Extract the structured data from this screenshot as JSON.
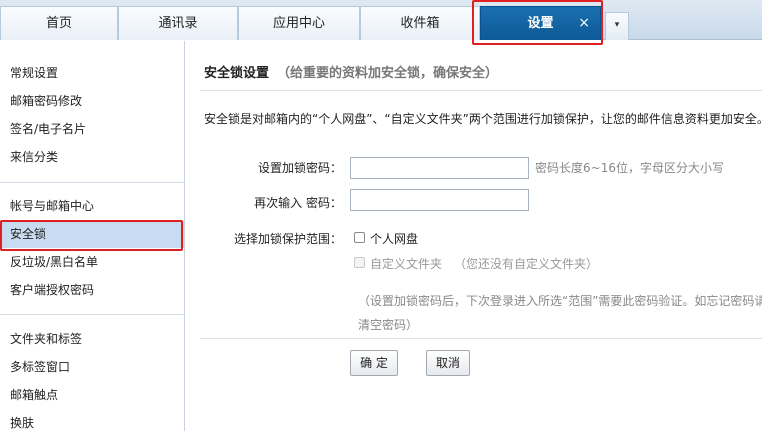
{
  "tabs": [
    {
      "label": "首页"
    },
    {
      "label": "通讯录"
    },
    {
      "label": "应用中心"
    },
    {
      "label": "收件箱"
    },
    {
      "label": "设置",
      "active": true
    }
  ],
  "tab_close": "×",
  "tab_more": "▾",
  "sidebar": {
    "groups": [
      [
        "常规设置",
        "邮箱密码修改",
        "签名/电子名片",
        "来信分类"
      ],
      [
        "帐号与邮箱中心",
        "安全锁",
        "反垃圾/黑白名单",
        "客户端授权密码"
      ],
      [
        "文件夹和标签",
        "多标签窗口",
        "邮箱触点",
        "换肤"
      ]
    ],
    "selected": "安全锁"
  },
  "main": {
    "title": "安全锁设置",
    "subtitle": "（给重要的资料加安全锁，确保安全）",
    "intro": "安全锁是对邮箱内的“个人网盘”、“自定义文件夹”两个范围进行加锁保护，让您的邮件信息资料更加安全。",
    "form": {
      "password_label": "设置加锁密码：",
      "password_value": "",
      "password_hint": "密码长度6~16位，字母区分大小写",
      "confirm_label": "再次输入 密码：",
      "confirm_value": "",
      "scope_label": "选择加锁保护范围：",
      "scope_personal": "个人网盘",
      "scope_custom": "自定义文件夹",
      "scope_custom_note": "（您还没有自定义文件夹）",
      "note_line1": "（设置加锁密码后，下次登录进入所选“范围”需要此密码验证。如忘记密码请联",
      "note_line2": "清空密码）"
    },
    "buttons": {
      "ok": "确 定",
      "cancel": "取消"
    }
  },
  "colors": {
    "active_tab": "#0d5a97",
    "selected_nav": "#c7dcf0",
    "highlight": "#e02020"
  }
}
